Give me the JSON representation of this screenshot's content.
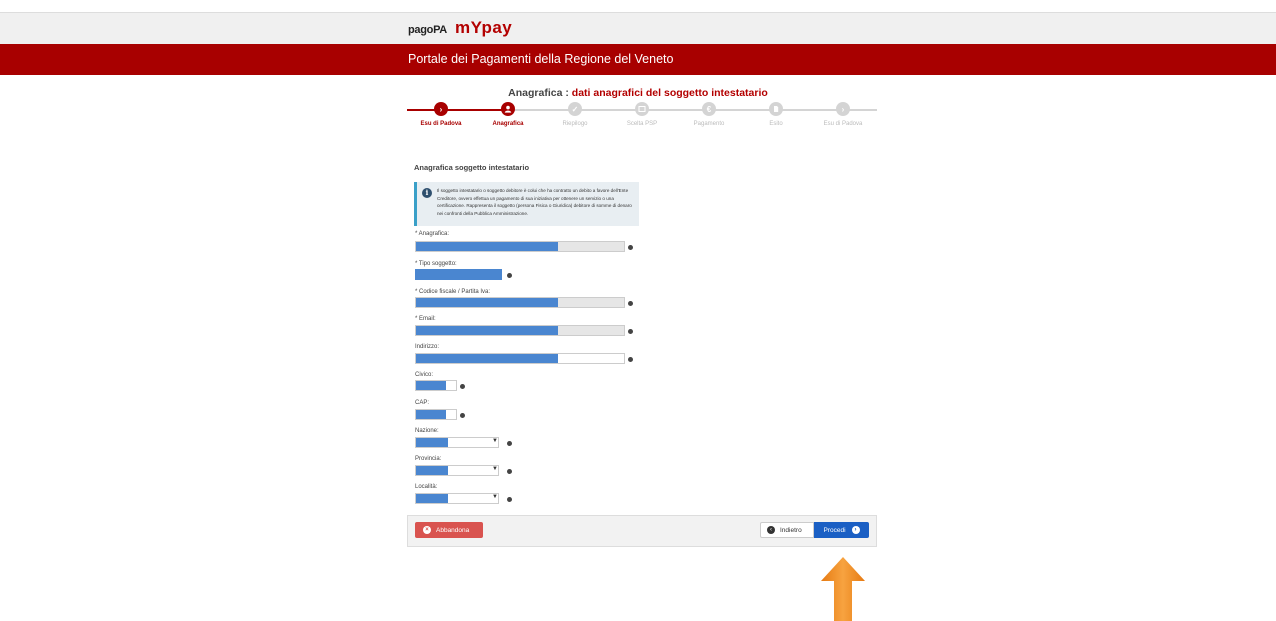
{
  "header": {
    "logo_pagopa": "pagoPA",
    "logo_mypay": "mYpay",
    "portal_title": "Portale dei Pagamenti della Regione del Veneto"
  },
  "step_header": {
    "label": "Anagrafica :",
    "subtitle": "dati anagrafici del soggetto intestatario"
  },
  "steps": [
    {
      "label": "Esu di Padova",
      "icon": "chevron-right-icon",
      "state": "active"
    },
    {
      "label": "Anagrafica",
      "icon": "user-icon",
      "state": "active"
    },
    {
      "label": "Riepilogo",
      "icon": "check-icon",
      "state": "inactive"
    },
    {
      "label": "Scelta PSP",
      "icon": "bank-icon",
      "state": "inactive"
    },
    {
      "label": "Pagamento",
      "icon": "euro-icon",
      "state": "inactive"
    },
    {
      "label": "Esito",
      "icon": "document-icon",
      "state": "inactive"
    },
    {
      "label": "Esu di Padova",
      "icon": "chevron-right-icon",
      "state": "inactive"
    }
  ],
  "form": {
    "section_title": "Anagrafica soggetto intestatario",
    "info_text": "Il soggetto intestatario o soggetto debitore è colui che ha contratto un debito a favore dell'Ente Creditore, ovvero effettua un pagamento di sua iniziativa per ottenere un servizio o una certificazione. Rappresenta il soggetto (persona Fisica o Giuridica) debitore di somme di denaro nei confronti della Pubblica Amministrazione.",
    "fields": {
      "anagrafica": "* Anagrafica:",
      "tipo_soggetto": "* Tipo soggetto:",
      "codice_fiscale": "* Codice fiscale / Partita Iva:",
      "email": "* Email:",
      "indirizzo": "Indirizzo:",
      "civico": "Civico:",
      "cap": "CAP:",
      "nazione": "Nazione:",
      "provincia": "Provincia:",
      "localita": "Località:"
    }
  },
  "footer": {
    "abbandona": "Abbandona",
    "indietro": "Indietro",
    "procedi": "Procedi"
  },
  "colors": {
    "brand_red": "#a80000",
    "primary_blue": "#1a5fc4",
    "danger": "#d9534f",
    "arrow_orange": "#f28c1e"
  }
}
